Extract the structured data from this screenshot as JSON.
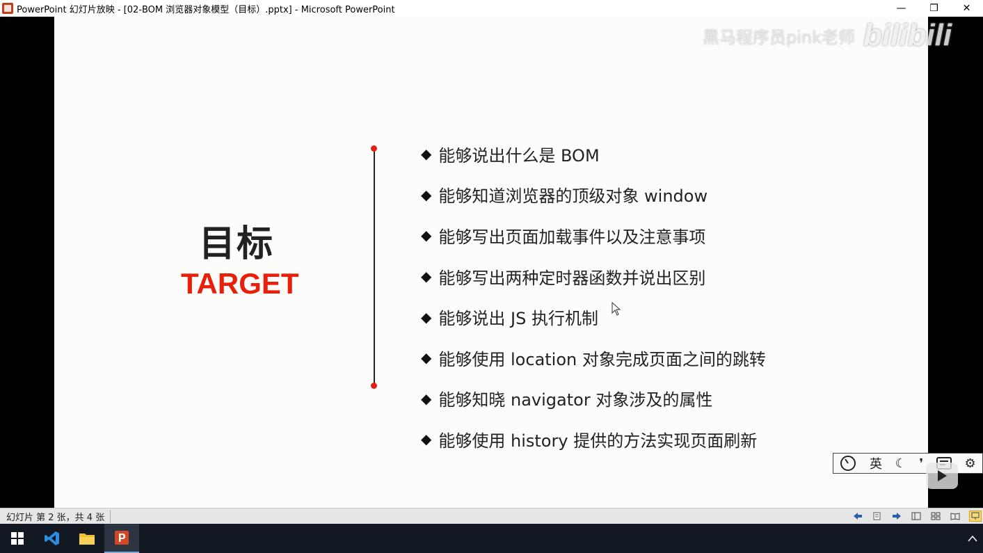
{
  "window": {
    "title": "PowerPoint 幻灯片放映 - [02-BOM 浏览器对象模型（目标）.pptx] - Microsoft PowerPoint",
    "minimize": "—",
    "restore": "❐",
    "close": "✕"
  },
  "slide": {
    "heading_zh": "目标",
    "heading_en": "TARGET",
    "items": [
      "能够说出什么是 BOM",
      "能够知道浏览器的顶级对象 window",
      "能够写出页面加载事件以及注意事项",
      "能够写出两种定时器函数并说出区别",
      "能够说出 JS 执行机制",
      "能够使用 location 对象完成页面之间的跳转",
      "能够知晓 navigator 对象涉及的属性",
      "能够使用 history 提供的方法实现页面刷新"
    ],
    "bullet": "◆",
    "accent_color": "#e8200a"
  },
  "watermark": {
    "text": "黑马程序员pink老师",
    "logo": "bilibili"
  },
  "video_tools": {
    "speed_icon": "speedometer-icon",
    "lang": "英",
    "moon": "☾",
    "quote": "❜",
    "settings": "⚙"
  },
  "statusbar": {
    "slide_info": "幻灯片 第 2 张，共 4 张"
  },
  "taskbar": {
    "apps": [
      "start-button",
      "vscode-icon",
      "file-explorer-icon",
      "powerpoint-icon"
    ]
  }
}
